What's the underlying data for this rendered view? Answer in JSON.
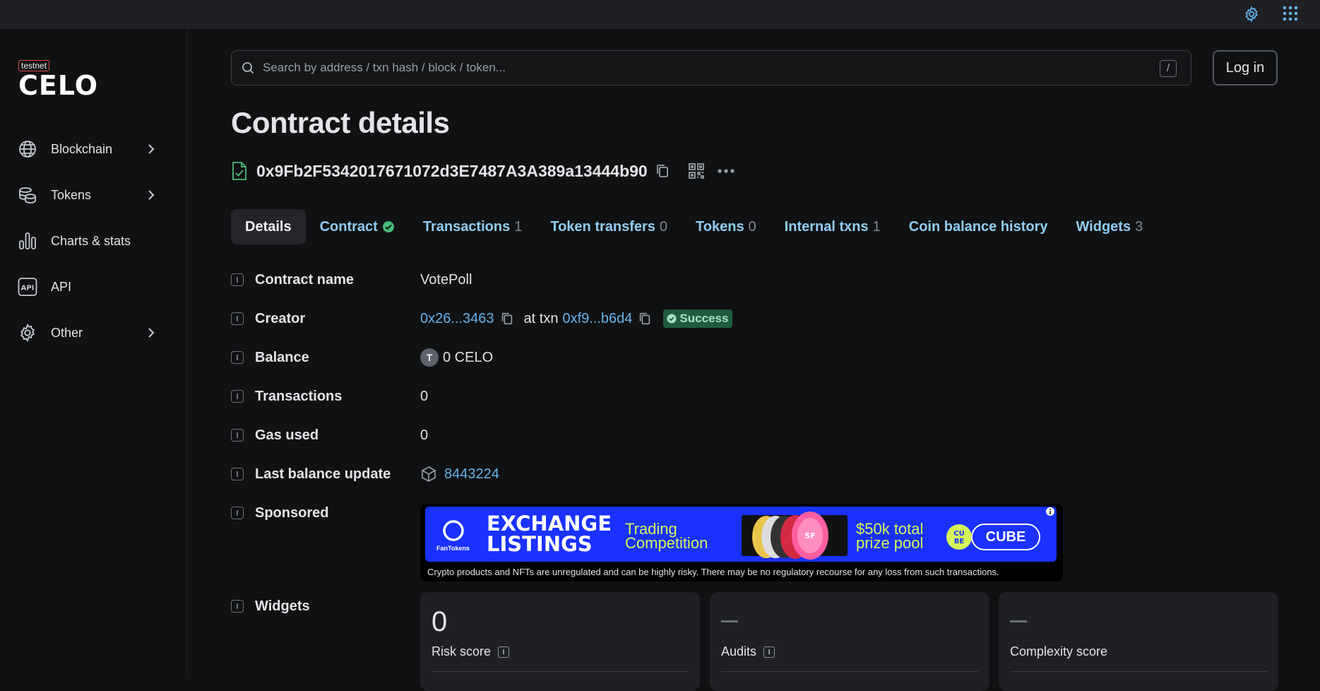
{
  "network_badge": "testnet",
  "logo_text": "CELO",
  "sidebar": {
    "items": [
      {
        "label": "Blockchain",
        "icon": "globe-icon",
        "has_submenu": true
      },
      {
        "label": "Tokens",
        "icon": "coins-icon",
        "has_submenu": true
      },
      {
        "label": "Charts & stats",
        "icon": "chart-icon",
        "has_submenu": false
      },
      {
        "label": "API",
        "icon": "api-icon",
        "has_submenu": false
      },
      {
        "label": "Other",
        "icon": "gear-icon",
        "has_submenu": true
      }
    ]
  },
  "search": {
    "placeholder": "Search by address / txn hash / block / token...",
    "shortcut": "/"
  },
  "login_label": "Log in",
  "page_title": "Contract details",
  "address": "0x9Fb2F5342017671072d3E7487A3A389a13444b90",
  "tabs": [
    {
      "label": "Details",
      "count": "",
      "active": true
    },
    {
      "label": "Contract",
      "count": "",
      "verified": true
    },
    {
      "label": "Transactions",
      "count": "1"
    },
    {
      "label": "Token transfers",
      "count": "0"
    },
    {
      "label": "Tokens",
      "count": "0"
    },
    {
      "label": "Internal txns",
      "count": "1"
    },
    {
      "label": "Coin balance history",
      "count": ""
    },
    {
      "label": "Widgets",
      "count": "3"
    }
  ],
  "details": {
    "contract_name": {
      "label": "Contract name",
      "value": "VotePoll"
    },
    "creator": {
      "label": "Creator",
      "address": "0x26...3463",
      "at_txn": "at txn",
      "txn": "0xf9...b6d4",
      "status": "Success"
    },
    "balance": {
      "label": "Balance",
      "token_letter": "T",
      "value": "0 CELO"
    },
    "transactions": {
      "label": "Transactions",
      "value": "0"
    },
    "gas_used": {
      "label": "Gas used",
      "value": "0"
    },
    "last_balance_update": {
      "label": "Last balance update",
      "value": "8443224"
    },
    "sponsored": {
      "label": "Sponsored"
    },
    "widgets": {
      "label": "Widgets"
    }
  },
  "ad": {
    "brand": "FanTokens",
    "headline_1": "EXCHANGE",
    "headline_2": "LISTINGS",
    "sub_1": "Trading",
    "sub_2": "Competition",
    "prize_1": "$50k total",
    "prize_2": "prize pool",
    "cta": "CUBE",
    "disclaimer": "Crypto products and NFTs are unregulated and can be highly risky. There may be no regulatory recourse for any loss from such transactions.",
    "colors": {
      "banner": "#1a31ff",
      "accent": "#d6f55a",
      "brand_color": "#ffffff"
    }
  },
  "widget_cards": [
    {
      "value": "0",
      "label": "Risk score",
      "has_info": true
    },
    {
      "value": "",
      "label": "Audits",
      "has_info": true
    },
    {
      "value": "",
      "label": "Complexity score",
      "has_info": false
    }
  ],
  "colors": {
    "background": "#101112",
    "link": "#63b3ed",
    "tab": "#90cdf4",
    "success_bg": "#1f5c3d",
    "verified": "#48bb78"
  }
}
